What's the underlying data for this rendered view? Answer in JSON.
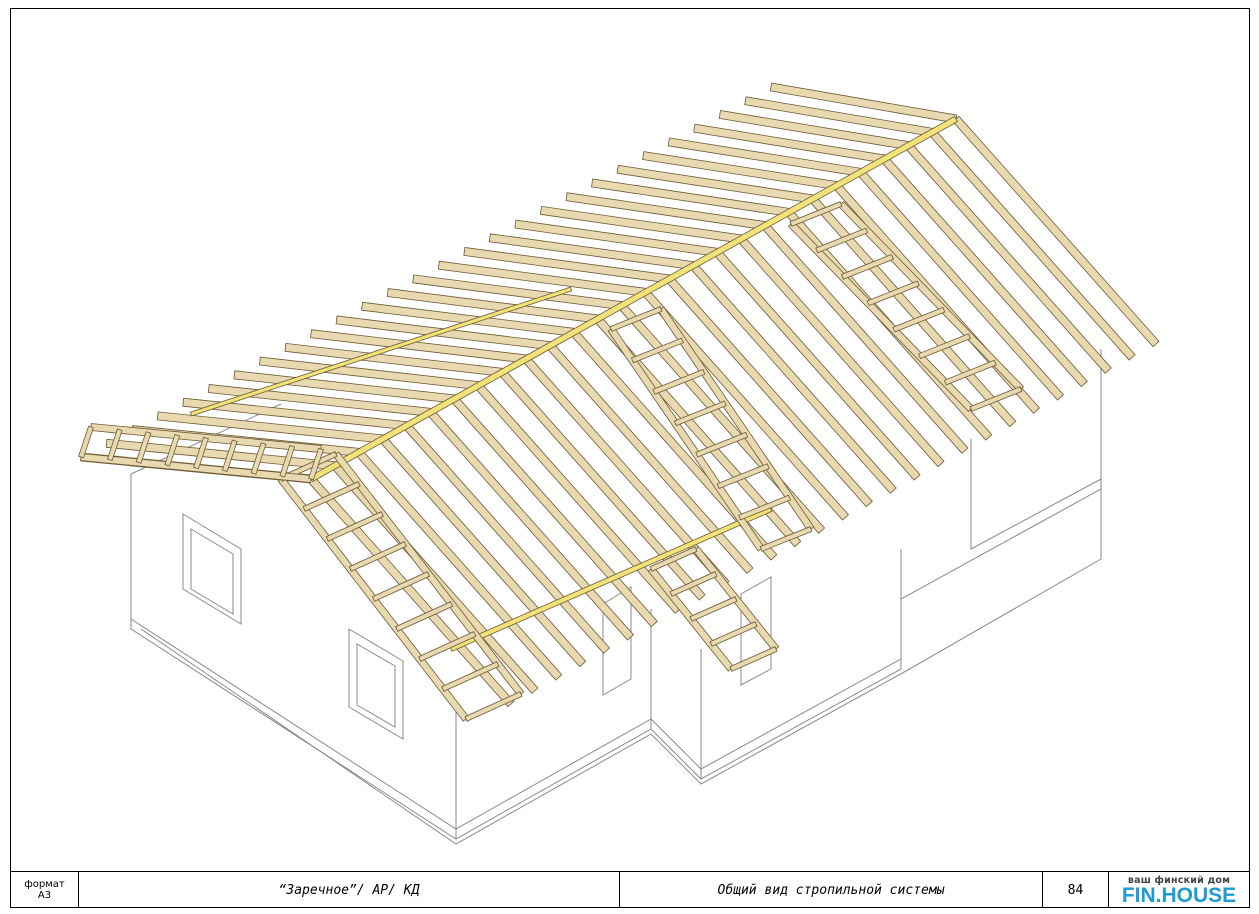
{
  "titleblock": {
    "format_label": "формат",
    "format_value": "А3",
    "project": "“Заречное”/ АР/ КД",
    "sheet_title": "Общий вид стропильной системы",
    "page_number": "84",
    "logo": {
      "tagline": "ваш финский дом",
      "brand": "FIN.HOUSE",
      "color": "#1d9bd7"
    }
  },
  "colors": {
    "timber": "#e8d9b0",
    "timber_edge": "#6b5a34",
    "ridge_beam": "#f2e27a",
    "walls": "#8a8a8a"
  }
}
